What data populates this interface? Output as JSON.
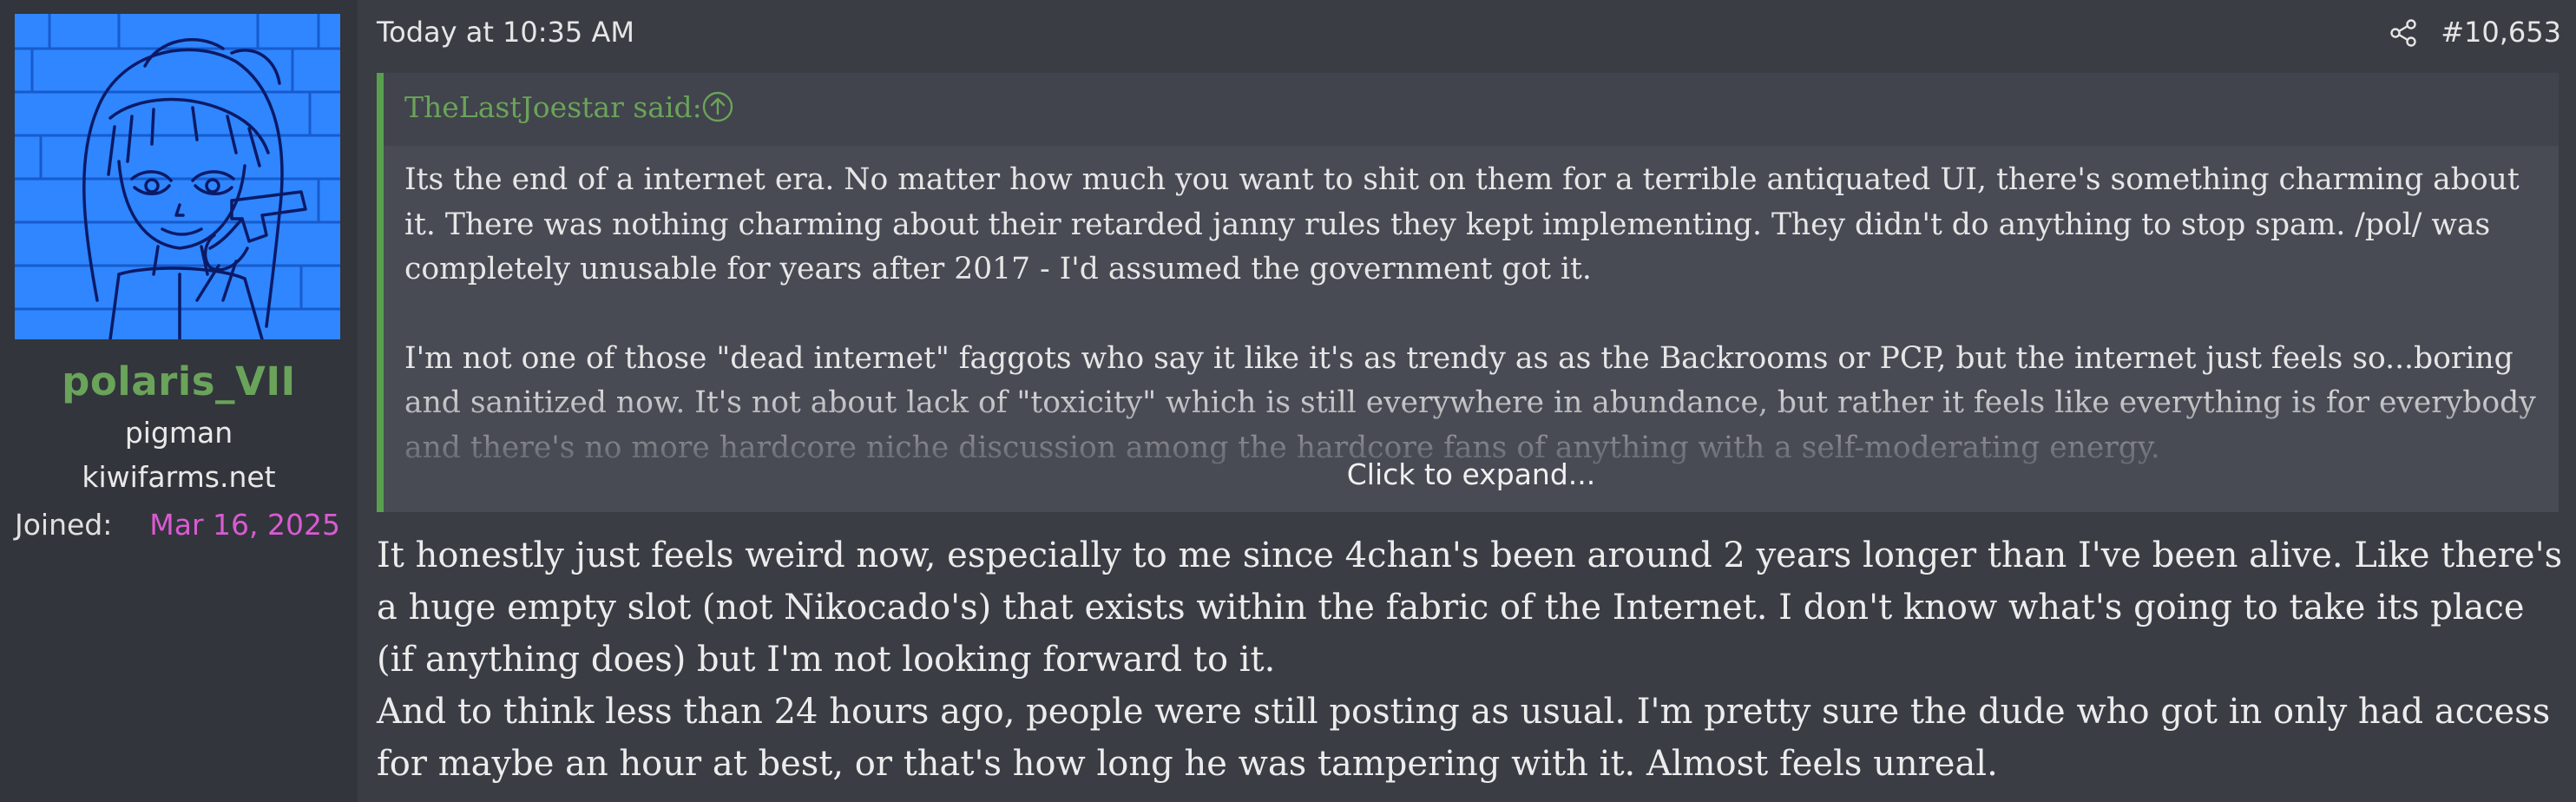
{
  "user": {
    "avatar_alt": "avatar",
    "name": "polaris_VII",
    "title_line1": "pigman",
    "title_line2": "kiwifarms.net",
    "joined_label": "Joined:",
    "joined_date": "Mar 16, 2025",
    "name_color": "#6aa35a",
    "date_color": "#d95bd3"
  },
  "post": {
    "timestamp": "Today at 10:35 AM",
    "share_icon": "share-icon",
    "number": "#10,653"
  },
  "quote": {
    "author": "TheLastJoestar said:",
    "jump_icon": "arrow-up-circle-icon",
    "paragraphs": [
      "Its the end of a internet era. No matter how much you want to shit on them for a terrible antiquated UI, there's something charming about it. There was nothing charming about their retarded janny rules they kept implementing. They didn't do anything to stop spam. /pol/ was completely unusable for years after 2017 - I'd assumed the government got it.",
      "I'm not one of those \"dead internet\" faggots who say it like it's as trendy as as the Backrooms or PCP, but the internet just feels so...boring and sanitized now. It's not about lack of \"toxicity\" which is still everywhere in abundance, but rather it feels like everything is for everybody and there's no more hardcore niche discussion among the hardcore fans of anything with a self-moderating energy."
    ],
    "expand_label": "Click to expand...",
    "accent_color": "#58a04f"
  },
  "message": {
    "paragraphs": [
      "It honestly just feels weird now, especially to me since 4chan's been around 2 years longer than I've been alive. Like there's a huge empty slot (not Nikocado's) that exists within the fabric of the Internet. I don't know what's going to take its place (if anything does) but I'm not looking forward to it.",
      "And to think less than 24 hours ago, people were still posting as usual. I'm pretty sure the dude who got in only had access for maybe an hour at best, or that's how long he was tampering with it. Almost feels unreal."
    ]
  }
}
